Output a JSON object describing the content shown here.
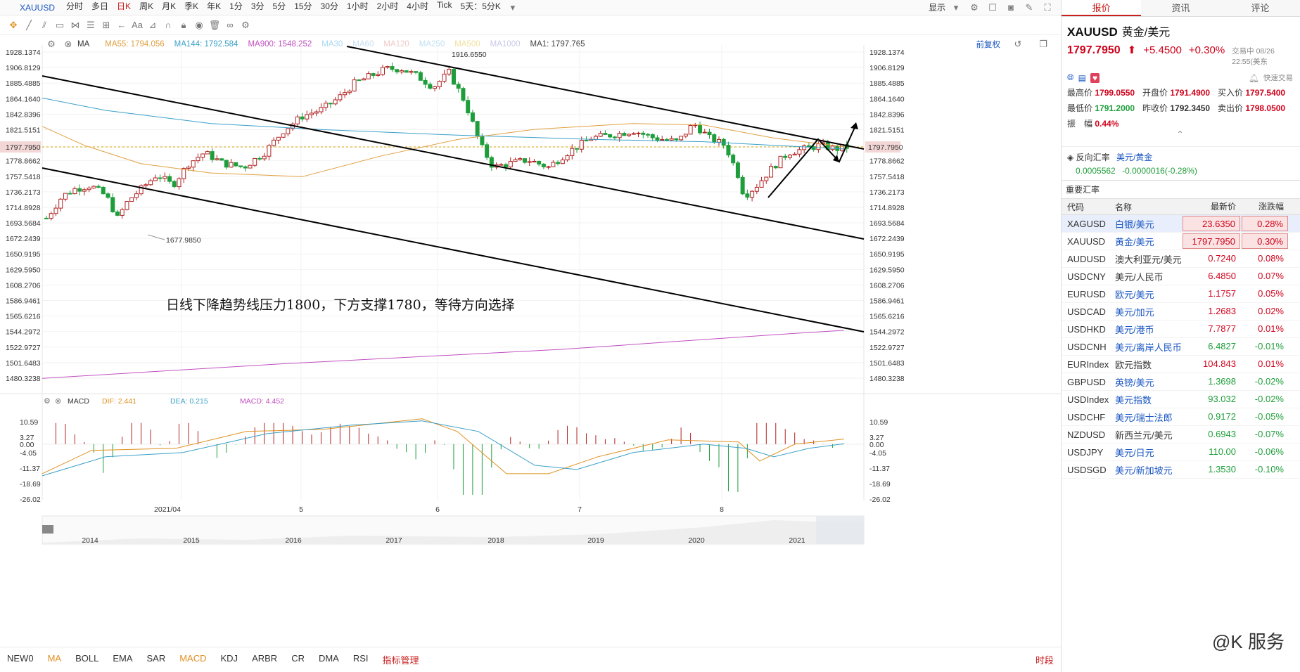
{
  "toolbar": {
    "symbol": "XAUUSD",
    "timeframes": [
      "分时",
      "多日",
      "日K",
      "周K",
      "月K",
      "季K",
      "年K",
      "1分",
      "3分",
      "5分",
      "15分",
      "30分",
      "1小时",
      "2小时",
      "4小时",
      "Tick",
      "5天：5分K"
    ],
    "active": "日K",
    "display_label": "显示"
  },
  "ma_legend": {
    "label": "MA",
    "items": [
      {
        "t": "MA55: 1794.056",
        "c": "#e0a040"
      },
      {
        "t": "MA144: 1792.584",
        "c": "#3aa0c8"
      },
      {
        "t": "MA900: 1548.252",
        "c": "#c050c0"
      },
      {
        "t": "MA30",
        "c": "#a8d8f0"
      },
      {
        "t": "MA60",
        "c": "#c8e0f0"
      },
      {
        "t": "MA120",
        "c": "#f0c8c8"
      },
      {
        "t": "MA250",
        "c": "#c0e0f0"
      },
      {
        "t": "MA500",
        "c": "#f0e0a0"
      },
      {
        "t": "MA1000",
        "c": "#c8c8e8"
      },
      {
        "t": "MA1: 1797.765",
        "c": "#444"
      }
    ],
    "restore": "前复权"
  },
  "price_axis": [
    "1928.1374",
    "1906.8129",
    "1885.4885",
    "1864.1640",
    "1842.8396",
    "1821.5151",
    "1797.7950",
    "1778.8662",
    "1757.5418",
    "1736.2173",
    "1714.8928",
    "1693.5684",
    "1672.2439",
    "1650.9195",
    "1629.5950",
    "1608.2706",
    "1586.9461",
    "1565.6216",
    "1544.2972",
    "1522.9727",
    "1501.6483",
    "1480.3238"
  ],
  "current_price": "1797.7950",
  "high_label": "1916.6550",
  "low_label": "1677.9850",
  "annotation": "日线下降趋势线压力1800，下方支撑1780，等待方向选择",
  "macd_legend": {
    "label": "MACD",
    "dif": "DIF: 2.441",
    "dea": "DEA: 0.215",
    "macd": "MACD: 4.452"
  },
  "macd_axis": [
    "10.59",
    "3.27",
    "0.00",
    "-4.05",
    "-11.37",
    "-18.69",
    "-26.02"
  ],
  "date_axis": [
    "2021/04",
    "5",
    "6",
    "7",
    "8"
  ],
  "overview_years": [
    "2014",
    "2015",
    "2016",
    "2017",
    "2018",
    "2019",
    "2020",
    "2021"
  ],
  "indicators": [
    "NEW0",
    "MA",
    "BOLL",
    "EMA",
    "SAR",
    "MACD",
    "KDJ",
    "ARBR",
    "CR",
    "DMA",
    "RSI",
    "指标管理"
  ],
  "active_indicators": [
    "MA",
    "MACD"
  ],
  "timezone_label": "时段",
  "right": {
    "tabs": [
      "报价",
      "资讯",
      "评论"
    ],
    "symbol": "XAUUSD",
    "name": "黄金/美元",
    "price": "1797.7950",
    "change": "+5.4500",
    "pct": "+0.30%",
    "time": "交易中 08/26 22:55(美东",
    "quick_trade": "快速交易",
    "stats": [
      [
        "最高价",
        "1799.0550",
        "开盘价",
        "1791.4900",
        "买入价",
        "1797.5400"
      ],
      [
        "最低价",
        "1791.2000",
        "昨收价",
        "1792.3450",
        "卖出价",
        "1798.0500"
      ]
    ],
    "amplitude_label": "振　幅",
    "amplitude": "0.44%",
    "reverse_label": "反向汇率",
    "reverse_pair": "美元/黄金",
    "reverse_value": "0.0005562",
    "reverse_change": "-0.0000016(-0.28%)",
    "section": "重要汇率",
    "cols": [
      "代码",
      "名称",
      "最新价",
      "涨跌幅"
    ],
    "rows": [
      [
        "XAGUSD",
        "白银/美元",
        "23.6350",
        "0.28%"
      ],
      [
        "XAUUSD",
        "黄金/美元",
        "1797.7950",
        "0.30%"
      ],
      [
        "AUDUSD",
        "澳大利亚元/美元",
        "0.7240",
        "0.08%"
      ],
      [
        "USDCNY",
        "美元/人民币",
        "6.4850",
        "0.07%"
      ],
      [
        "EURUSD",
        "欧元/美元",
        "1.1757",
        "0.05%"
      ],
      [
        "USDCAD",
        "美元/加元",
        "1.2683",
        "0.02%"
      ],
      [
        "USDHKD",
        "美元/港币",
        "7.7877",
        "0.01%"
      ],
      [
        "USDCNH",
        "美元/离岸人民币",
        "6.4827",
        "-0.01%"
      ],
      [
        "EURIndex",
        "欧元指数",
        "104.843",
        "0.01%"
      ],
      [
        "GBPUSD",
        "英镑/美元",
        "1.3698",
        "-0.02%"
      ],
      [
        "USDIndex",
        "美元指数",
        "93.032",
        "-0.02%"
      ],
      [
        "USDCHF",
        "美元/瑞士法郎",
        "0.9172",
        "-0.05%"
      ],
      [
        "NZDUSD",
        "新西兰元/美元",
        "0.6943",
        "-0.07%"
      ],
      [
        "USDJPY",
        "美元/日元",
        "110.00",
        "-0.06%"
      ],
      [
        "USDSGD",
        "美元/新加坡元",
        "1.3530",
        "-0.10%"
      ]
    ]
  },
  "watermark": "@K 服务",
  "colors": {
    "up": "#b22222",
    "down": "#1e9e3a",
    "accent": "#1a56c2"
  }
}
